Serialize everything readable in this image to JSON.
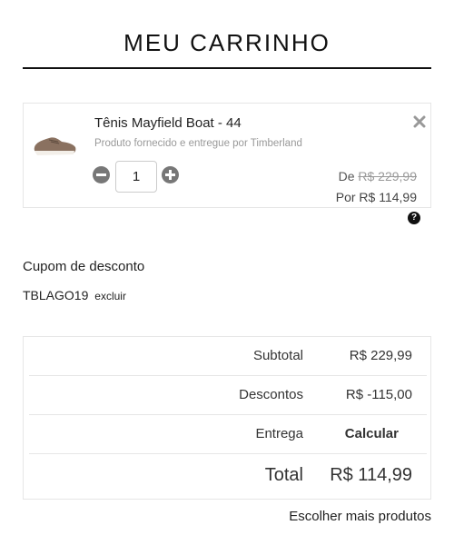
{
  "page": {
    "title": "MEU CARRINHO"
  },
  "cart_item": {
    "name": "Tênis Mayfield Boat - 44",
    "seller": "Produto fornecido e entregue por Timberland",
    "quantity": "1",
    "price_from_label": "De",
    "price_from": "R$ 229,99",
    "price_now": "Por R$ 114,99",
    "image_icon": "shoe-image",
    "remove_icon": "close-icon"
  },
  "help": {
    "icon": "question-icon",
    "glyph": "?"
  },
  "coupon": {
    "label": "Cupom de desconto",
    "code": "TBLAGO19",
    "remove_label": "excluir"
  },
  "summary": {
    "subtotal_label": "Subtotal",
    "subtotal_value": "R$ 229,99",
    "discount_label": "Descontos",
    "discount_value": "R$ -115,00",
    "shipping_label": "Entrega",
    "shipping_value": "Calcular",
    "total_label": "Total",
    "total_value": "R$ 114,99"
  },
  "footer": {
    "more_products": "Escolher mais produtos"
  },
  "colors": {
    "text": "#222222",
    "muted": "#999999",
    "border": "#e6e6e6",
    "icon": "#777777"
  }
}
